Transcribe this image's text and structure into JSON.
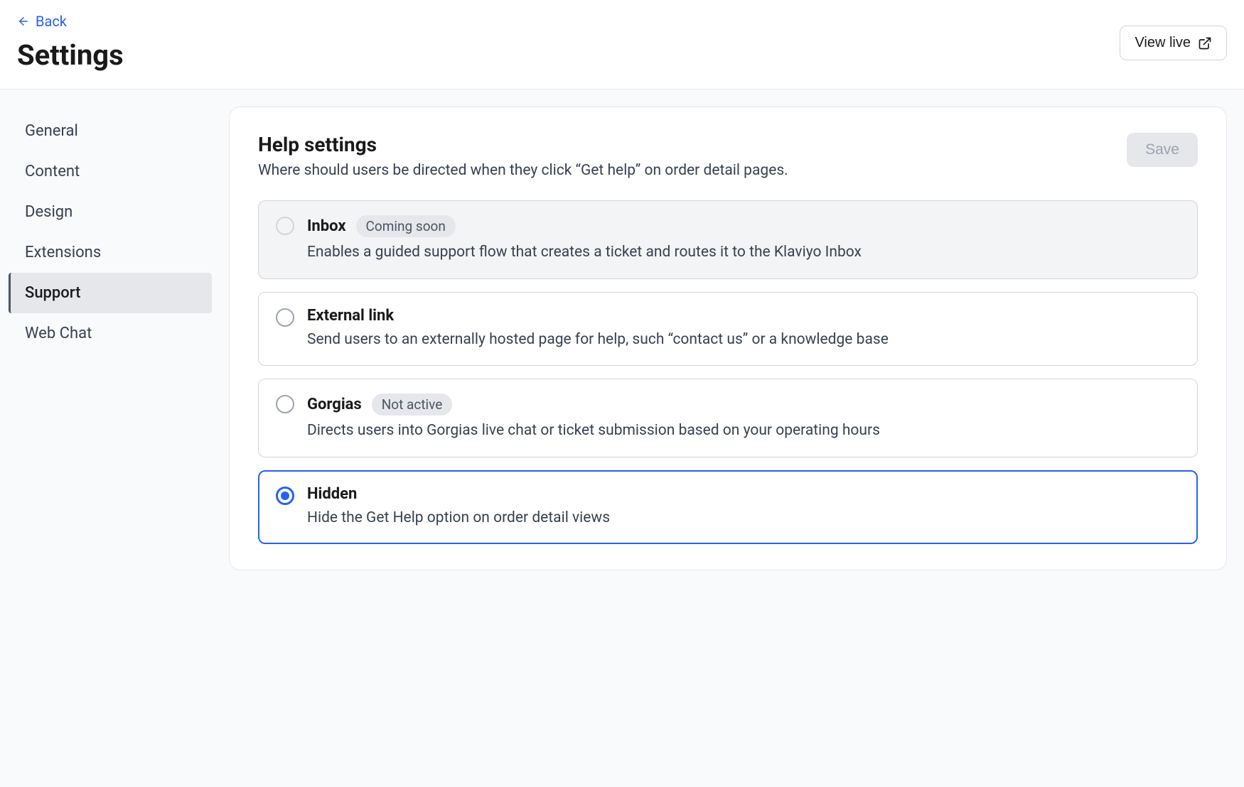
{
  "header": {
    "back_label": "Back",
    "page_title": "Settings",
    "view_live_label": "View live"
  },
  "sidebar": {
    "items": [
      {
        "label": "General",
        "active": false
      },
      {
        "label": "Content",
        "active": false
      },
      {
        "label": "Design",
        "active": false
      },
      {
        "label": "Extensions",
        "active": false
      },
      {
        "label": "Support",
        "active": true
      },
      {
        "label": "Web Chat",
        "active": false
      }
    ]
  },
  "card": {
    "title": "Help settings",
    "subtitle": "Where should users be directed when they click “Get help” on order detail pages.",
    "save_label": "Save"
  },
  "options": [
    {
      "id": "inbox",
      "title": "Inbox",
      "badge": "Coming soon",
      "description": "Enables a guided support flow that creates a ticket and routes it to the Klaviyo Inbox",
      "disabled": true,
      "selected": false
    },
    {
      "id": "external",
      "title": "External link",
      "badge": null,
      "description": "Send users to an externally hosted page for help, such “contact us” or a knowledge base",
      "disabled": false,
      "selected": false
    },
    {
      "id": "gorgias",
      "title": "Gorgias",
      "badge": "Not active",
      "description": "Directs users into Gorgias live chat or ticket submission based on your operating hours",
      "disabled": false,
      "selected": false
    },
    {
      "id": "hidden",
      "title": "Hidden",
      "badge": null,
      "description": "Hide the Get Help option on order detail views",
      "disabled": false,
      "selected": true
    }
  ]
}
